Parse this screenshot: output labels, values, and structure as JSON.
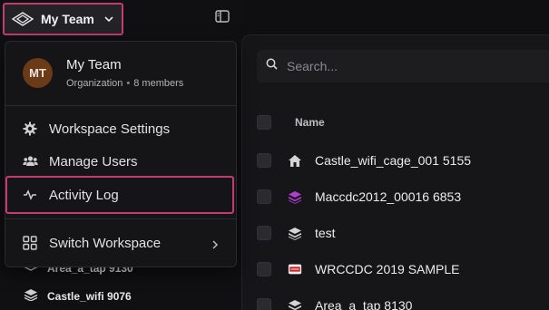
{
  "header": {
    "team_label": "My Team"
  },
  "menu": {
    "avatar_initials": "MT",
    "org_name": "My Team",
    "org_type": "Organization",
    "org_members": "8 members",
    "items": [
      {
        "label": "Workspace Settings",
        "icon": "gear-icon"
      },
      {
        "label": "Manage Users",
        "icon": "users-icon"
      },
      {
        "label": "Activity Log",
        "icon": "activity-icon"
      },
      {
        "label": "Switch Workspace",
        "icon": "grid-icon"
      }
    ]
  },
  "sidebar": {
    "items": [
      {
        "label": "Area_a_tap 9130",
        "icon": "stack-icon"
      },
      {
        "label": "Castle_wifi 9076",
        "icon": "stack-icon"
      }
    ]
  },
  "main": {
    "search_placeholder": "Search...",
    "column_name": "Name",
    "rows": [
      {
        "label": "Castle_wifi_cage_001 5155",
        "icon": "house-icon"
      },
      {
        "label": "Maccdc2012_00016 6853",
        "icon": "stack-purple-icon"
      },
      {
        "label": "test",
        "icon": "stack-icon"
      },
      {
        "label": "WRCCDC 2019 SAMPLE",
        "icon": "badge-icon"
      },
      {
        "label": "Area_a_tap 8130",
        "icon": "stack-icon"
      }
    ]
  },
  "colors": {
    "accent_border": "#c43c6e",
    "avatar_bg": "#6b3a16",
    "purple_stack": "#b03fd1"
  }
}
